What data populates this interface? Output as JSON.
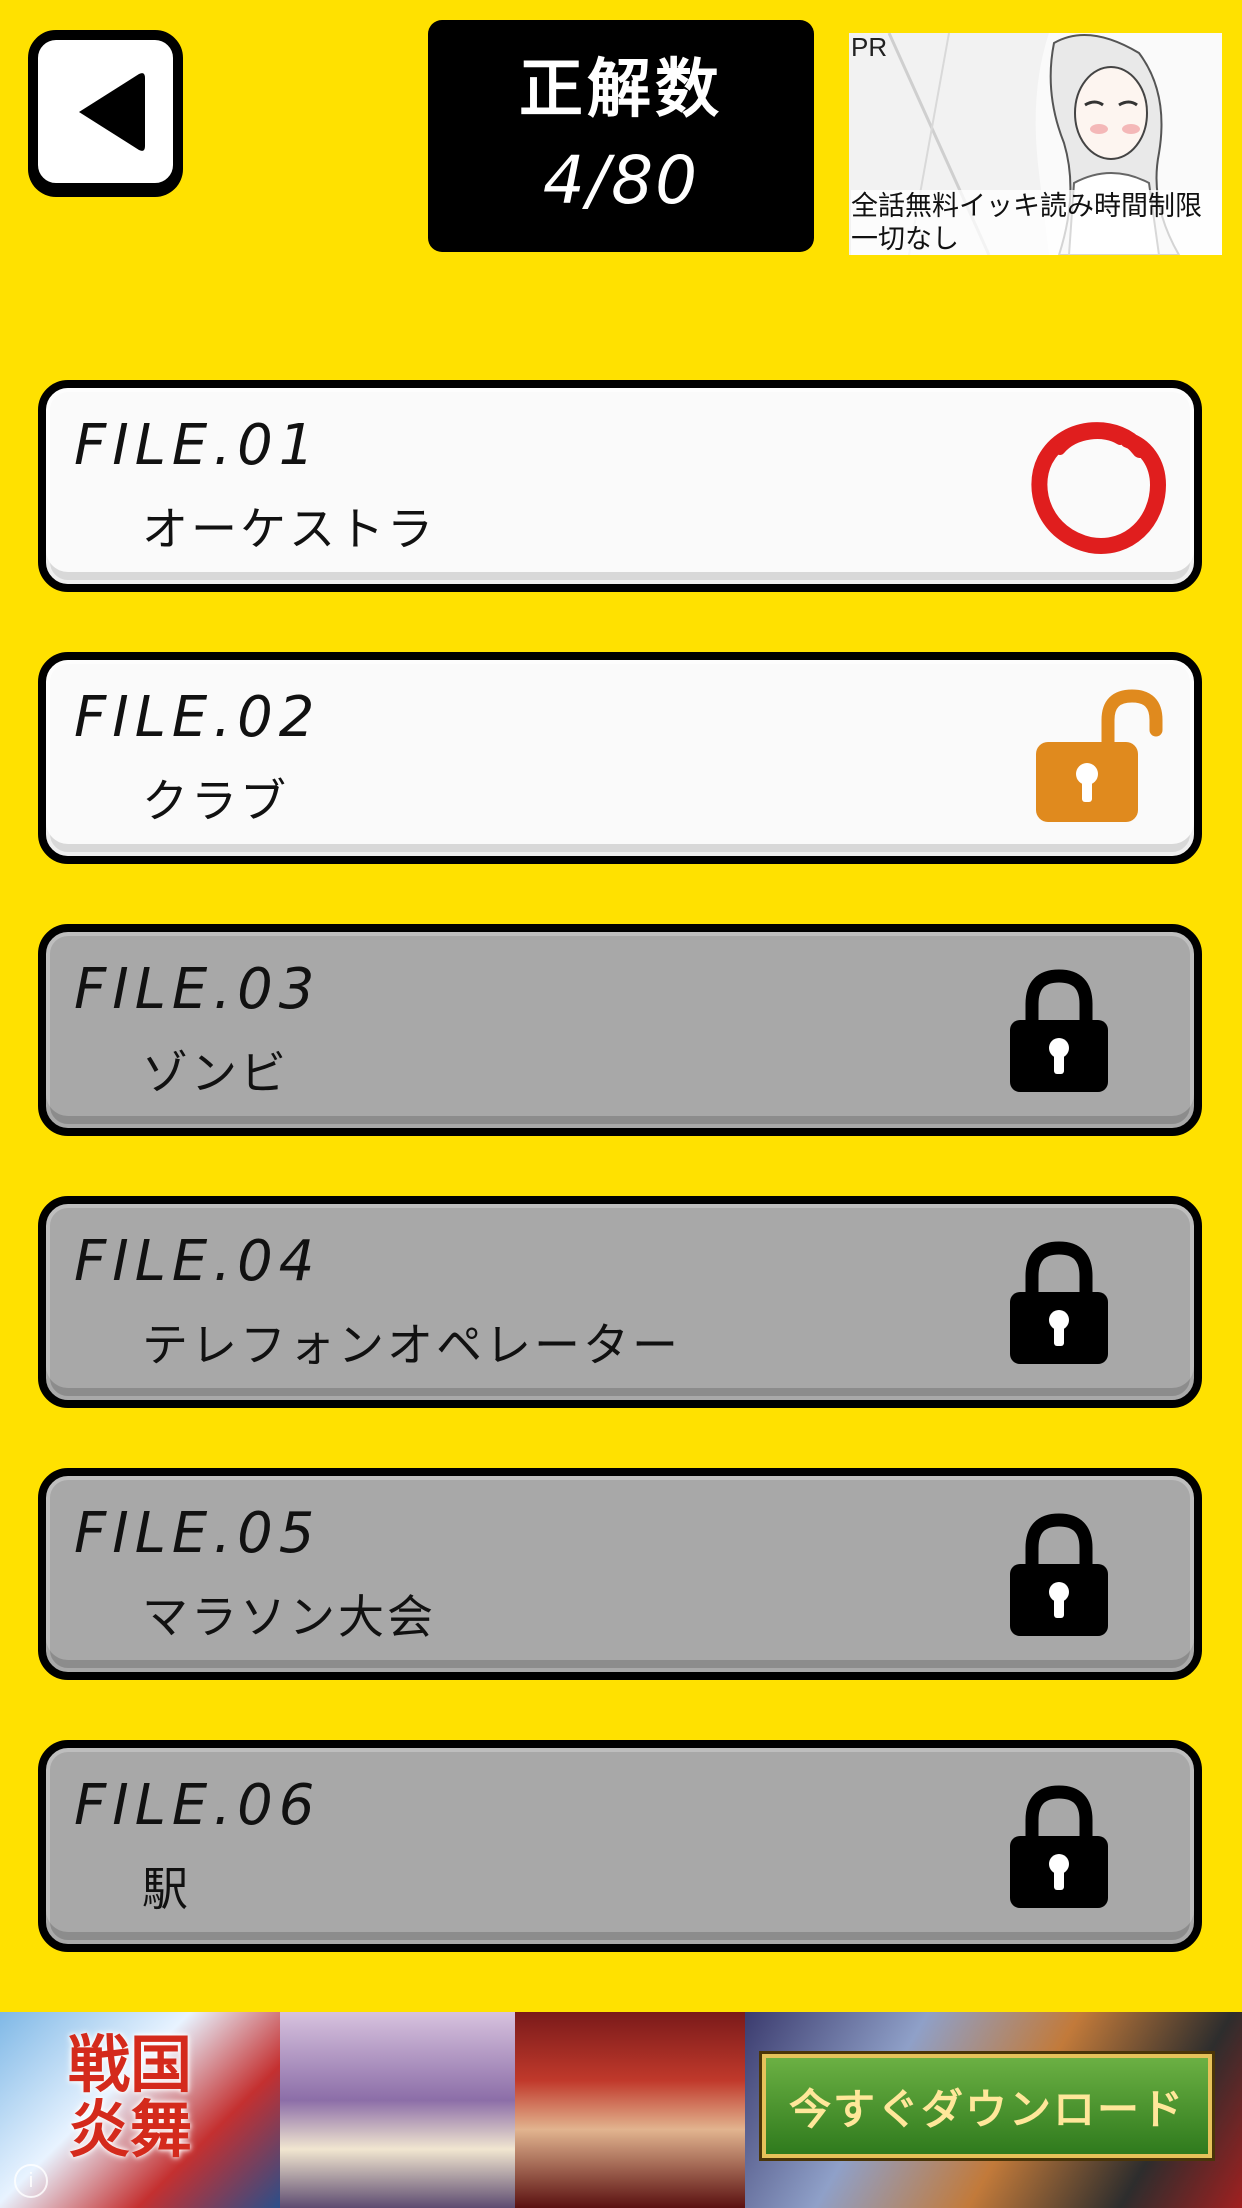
{
  "header": {
    "back_icon": "triangle-left-icon",
    "score_title": "正解数",
    "score_value": "4/80",
    "score_correct": 4,
    "score_total": 80
  },
  "top_ad": {
    "pr_label": "PR",
    "caption": "全話無料イッキ読み時間制限一切なし"
  },
  "files": [
    {
      "number": "FILE.01",
      "name": "オーケストラ",
      "status": "cleared",
      "icon": "red-circle-icon"
    },
    {
      "number": "FILE.02",
      "name": "クラブ",
      "status": "unlocked",
      "icon": "unlocked-padlock-icon"
    },
    {
      "number": "FILE.03",
      "name": "ゾンビ",
      "status": "locked",
      "icon": "padlock-icon"
    },
    {
      "number": "FILE.04",
      "name": "テレフォンオペレーター",
      "status": "locked",
      "icon": "padlock-icon"
    },
    {
      "number": "FILE.05",
      "name": "マラソン大会",
      "status": "locked",
      "icon": "padlock-icon"
    },
    {
      "number": "FILE.06",
      "name": "駅",
      "status": "locked",
      "icon": "padlock-icon"
    }
  ],
  "bottom_ad": {
    "logo_text": "戦国炎舞",
    "cta_label": "今すぐダウンロード",
    "info_icon": "i"
  },
  "colors": {
    "background": "#ffe100",
    "open_card": "#fafafa",
    "locked_card": "#a8a8a8",
    "cleared_mark": "#e01e1e",
    "unlocked_lock": "#e08a1e",
    "locked_lock": "#000000"
  }
}
